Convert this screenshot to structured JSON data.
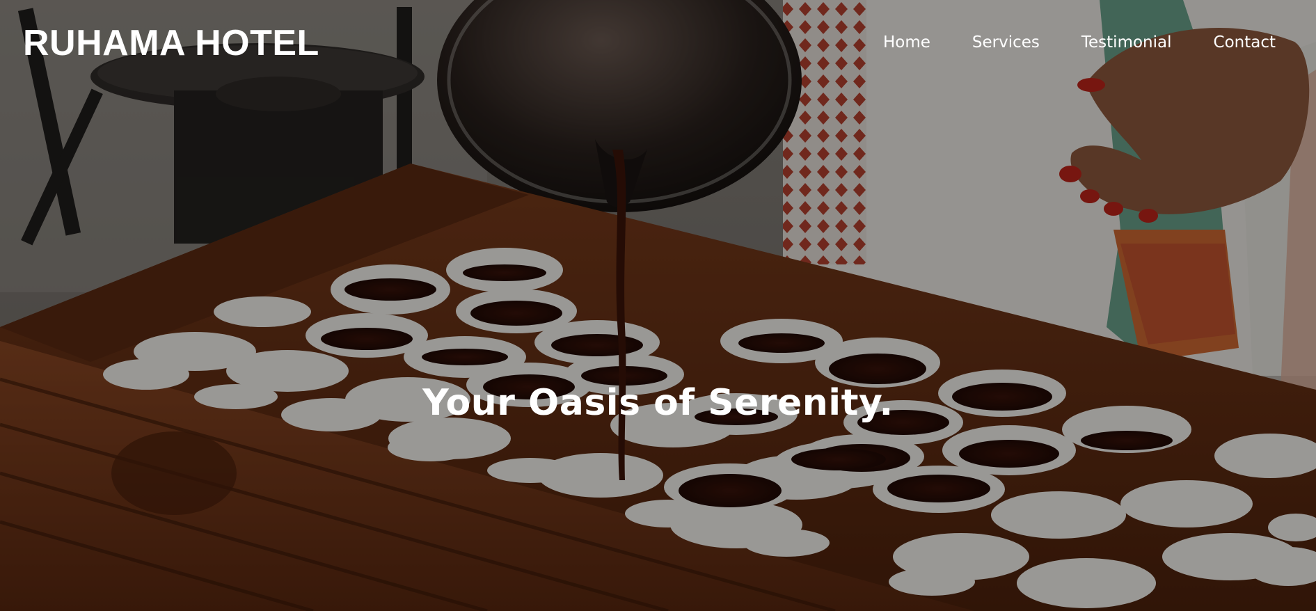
{
  "header": {
    "brand": "RUHAMA HOTEL"
  },
  "nav": {
    "items": [
      {
        "label": "Home"
      },
      {
        "label": "Services"
      },
      {
        "label": "Testimonial"
      },
      {
        "label": "Contact"
      }
    ]
  },
  "hero": {
    "tagline": "Your Oasis of Serenity.",
    "background_image": "coffee-ceremony-photo",
    "overlay_color": "#000000"
  }
}
